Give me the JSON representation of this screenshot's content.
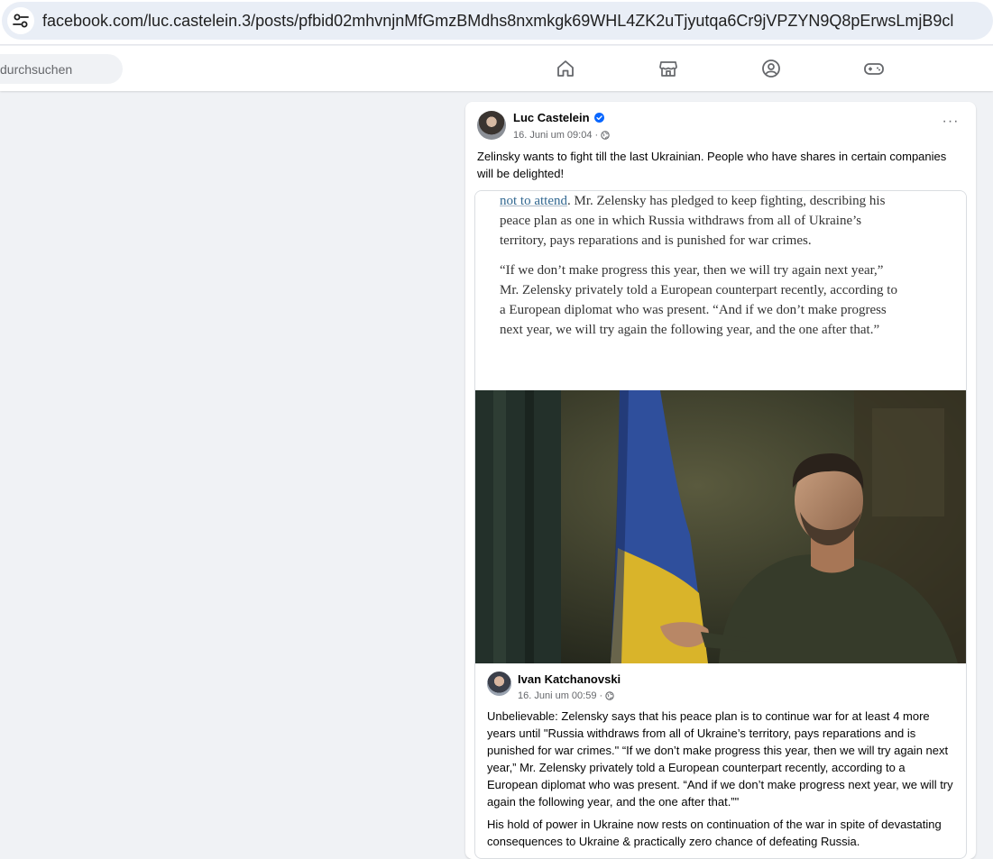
{
  "browser": {
    "url": "facebook.com/luc.castelein.3/posts/pfbid02mhvnjnMfGmzBMdhs8nxmkgk69WHL4ZK2uTjyutqa6Cr9jVPZYN9Q8pErwsLmjB9cl",
    "site_icon": "tune-icon"
  },
  "nav": {
    "search_placeholder": "durchsuchen",
    "icons": [
      "home-icon",
      "marketplace-icon",
      "groups-icon",
      "gaming-icon"
    ]
  },
  "post": {
    "author": "Luc Castelein",
    "verified": true,
    "timestamp": "16. Juni um 09:04 ·",
    "text": "Zelinsky wants to fight till the last Ukrainian. People who have shares in certain companies will be delighted!",
    "more_label": "···",
    "shared": {
      "article": {
        "link_text": "not to attend",
        "p1_rest": ". Mr. Zelensky has pledged to keep fighting, describing his peace plan as one in which Russia withdraws from all of Ukraine’s territory, pays reparations and is punished for war crimes.",
        "p2": "“If we don’t make progress this year, then we will try again next year,” Mr. Zelensky privately told a European counterpart recently, according to a European diplomat who was present. “And if we don’t make progress next year, we will try again the following year, and the one after that.”"
      },
      "original_author": "Ivan Katchanovski",
      "original_timestamp": "16. Juni um 00:59 ·",
      "original_text_1": "Unbelievable: Zelensky says that his peace plan is to continue war for at least 4 more years until \"Russia withdraws from all of Ukraine’s territory, pays reparations and is punished for war crimes.\" “If we don’t make progress this year, then we will try again next year,” Mr. Zelensky privately told a European counterpart recently, according to a European diplomat who was present. “And if we don’t make progress next year, we will try again the following year, and the one after that.”\"",
      "original_text_2": "His hold of power in Ukraine now rests on continuation of the war in spite of devastating consequences to Ukraine & practically zero chance of defeating Russia."
    }
  },
  "colors": {
    "page_bg": "#f0f2f5",
    "verified_blue": "#0866ff",
    "link_blue": "#326891"
  }
}
